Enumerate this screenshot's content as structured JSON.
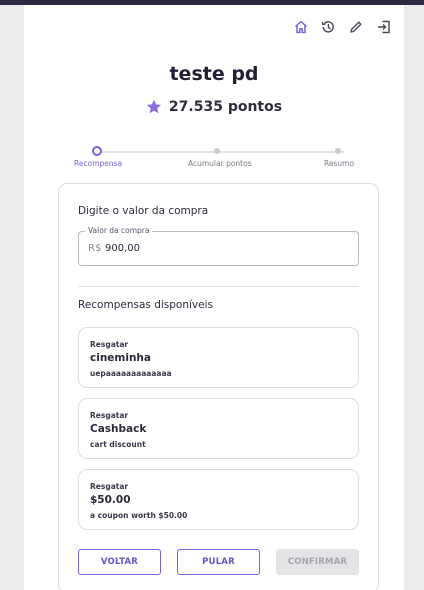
{
  "header": {
    "title": "teste pd",
    "points_label": "27.535 pontos"
  },
  "toolbar": {
    "icons": [
      "home-icon",
      "history-icon",
      "edit-icon",
      "logout-icon"
    ]
  },
  "stepper": {
    "steps": [
      {
        "label": "Recompensa",
        "active": true
      },
      {
        "label": "Acumular pontos",
        "active": false
      },
      {
        "label": "Resumo",
        "active": false
      }
    ]
  },
  "purchase": {
    "section_title": "Digite o valor da compra",
    "field_label": "Valor da compra",
    "currency_prefix": "R$",
    "value": "900,00"
  },
  "rewards": {
    "section_title": "Recompensas disponíveis",
    "items": [
      {
        "action": "Resgatar",
        "name": "cineminha",
        "description": "uepaaaaaaaaaaaaa"
      },
      {
        "action": "Resgatar",
        "name": "Cashback",
        "description": "cart discount"
      },
      {
        "action": "Resgatar",
        "name": "$50.00",
        "description": "a coupon worth $50.00"
      }
    ]
  },
  "actions": {
    "back_label": "VOLTAR",
    "skip_label": "PULAR",
    "confirm_label": "CONFIRMAR"
  },
  "colors": {
    "accent": "#7b61d9",
    "star": "#8b6fe0",
    "top_bar": "#2e2843",
    "page_background": "#ececec"
  }
}
